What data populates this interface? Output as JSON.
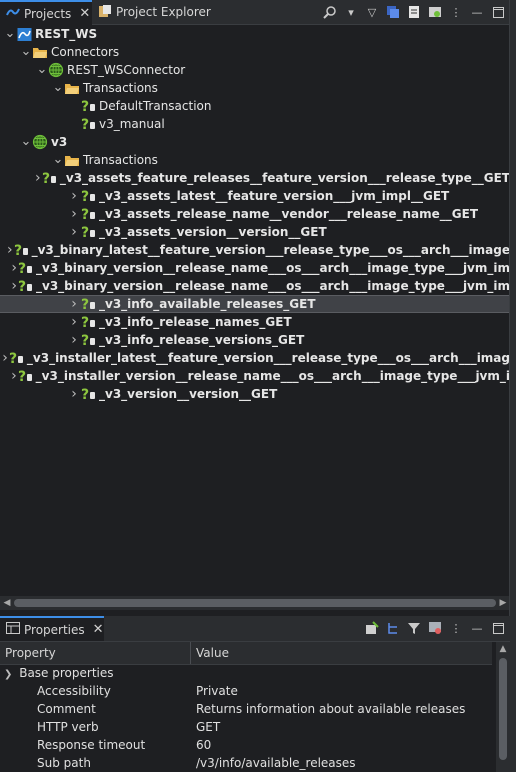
{
  "projects_panel": {
    "tabs": [
      {
        "label": "Projects",
        "active": true,
        "closable": true
      },
      {
        "label": "Project Explorer",
        "active": false,
        "closable": false
      }
    ],
    "toolbar_icons": [
      "search-icon",
      "chevron-down-icon",
      "filter-icon",
      "collapse-all-icon",
      "link-icon",
      "refresh-icon",
      "settings-icon",
      "more-vert-icon",
      "minimize-icon",
      "maximize-icon"
    ],
    "tree": [
      {
        "label": "REST_WS",
        "level": 0,
        "expanded": true,
        "icon": "project-icon",
        "bold": true
      },
      {
        "label": "Connectors",
        "level": 1,
        "expanded": true,
        "icon": "folder-icon"
      },
      {
        "label": "REST_WSConnector",
        "level": 2,
        "expanded": true,
        "icon": "connector-icon"
      },
      {
        "label": "Transactions",
        "level": 3,
        "expanded": true,
        "icon": "folder-icon"
      },
      {
        "label": "DefaultTransaction",
        "level": 4,
        "icon": "transaction-icon"
      },
      {
        "label": "v3_manual",
        "level": 4,
        "icon": "transaction-icon"
      },
      {
        "label": "v3",
        "level": 1,
        "expanded": true,
        "icon": "connector-icon",
        "bold": true
      },
      {
        "label": "Transactions",
        "level": 3,
        "expanded": true,
        "icon": "folder-icon"
      },
      {
        "label": "_v3_assets_feature_releases__feature_version___release_type__GET",
        "level": 4,
        "collapsed": true,
        "icon": "transaction-icon",
        "bold": true
      },
      {
        "label": "_v3_assets_latest__feature_version___jvm_impl__GET",
        "level": 4,
        "collapsed": true,
        "icon": "transaction-icon",
        "bold": true
      },
      {
        "label": "_v3_assets_release_name__vendor___release_name__GET",
        "level": 4,
        "collapsed": true,
        "icon": "transaction-icon",
        "bold": true
      },
      {
        "label": "_v3_assets_version__version__GET",
        "level": 4,
        "collapsed": true,
        "icon": "transaction-icon",
        "bold": true
      },
      {
        "label": "_v3_binary_latest__feature_version___release_type___os___arch___image",
        "level": 4,
        "collapsed": true,
        "icon": "transaction-icon",
        "bold": true
      },
      {
        "label": "_v3_binary_version__release_name___os___arch___image_type___jvm_im",
        "level": 4,
        "collapsed": true,
        "icon": "transaction-icon",
        "bold": true
      },
      {
        "label": "_v3_binary_version__release_name___os___arch___image_type___jvm_im",
        "level": 4,
        "collapsed": true,
        "icon": "transaction-icon",
        "bold": true
      },
      {
        "label": "_v3_info_available_releases_GET",
        "level": 4,
        "collapsed": true,
        "icon": "transaction-icon",
        "bold": true,
        "selected": true
      },
      {
        "label": "_v3_info_release_names_GET",
        "level": 4,
        "collapsed": true,
        "icon": "transaction-icon",
        "bold": true
      },
      {
        "label": "_v3_info_release_versions_GET",
        "level": 4,
        "collapsed": true,
        "icon": "transaction-icon",
        "bold": true
      },
      {
        "label": "_v3_installer_latest__feature_version___release_type___os___arch___imag",
        "level": 4,
        "collapsed": true,
        "icon": "transaction-icon",
        "bold": true
      },
      {
        "label": "_v3_installer_version__release_name___os___arch___image_type___jvm_i",
        "level": 4,
        "collapsed": true,
        "icon": "transaction-icon",
        "bold": true
      },
      {
        "label": "_v3_version__version__GET",
        "level": 4,
        "collapsed": true,
        "icon": "transaction-icon",
        "bold": true
      }
    ]
  },
  "properties_panel": {
    "tab_label": "Properties",
    "toolbar_icons": [
      "pin-icon",
      "tree-icon",
      "filter-icon",
      "restore-icon",
      "more-vert-icon",
      "minimize-icon",
      "maximize-icon"
    ],
    "columns": {
      "property": "Property",
      "value": "Value"
    },
    "group": "Base properties",
    "rows": [
      {
        "key": "Accessibility",
        "value": "Private"
      },
      {
        "key": "Comment",
        "value": "Returns information about available releases"
      },
      {
        "key": "HTTP verb",
        "value": "GET"
      },
      {
        "key": "Response timeout",
        "value": "60"
      },
      {
        "key": "Sub path",
        "value": "/v3/info/available_releases"
      }
    ]
  },
  "colors": {
    "accent": "#3d8ee8",
    "background": "#1e1f22",
    "selection": "#404247",
    "folder": "#e8b44a",
    "connector": "#6fbf3a",
    "transaction": "#8dc63f"
  }
}
